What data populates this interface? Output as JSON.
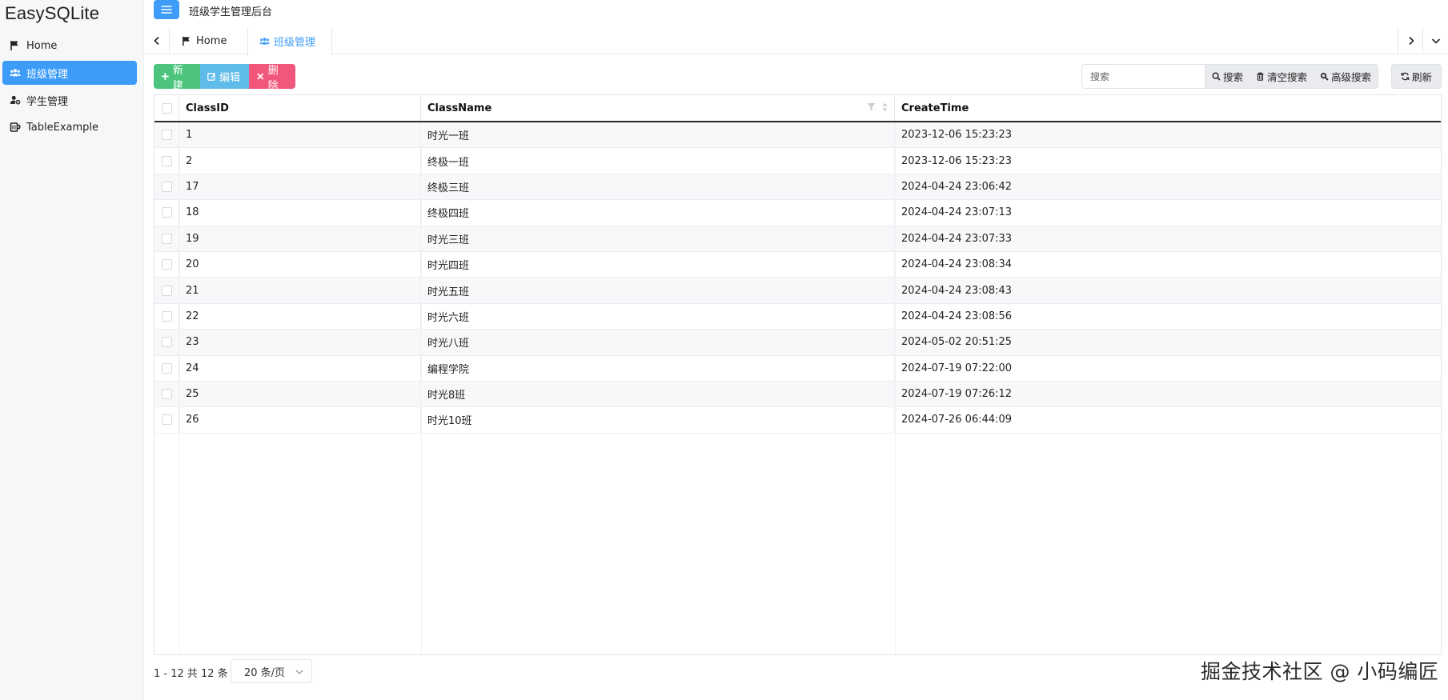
{
  "brand": "EasySQLite",
  "header": {
    "title": "班级学生管理后台"
  },
  "sidebar": {
    "items": [
      {
        "label": "Home",
        "icon": "flag-icon",
        "active": false
      },
      {
        "label": "班级管理",
        "icon": "users-icon",
        "active": true
      },
      {
        "label": "学生管理",
        "icon": "user-cog-icon",
        "active": false
      },
      {
        "label": "TableExample",
        "icon": "mug-icon",
        "active": false
      }
    ]
  },
  "tabs": [
    {
      "label": "Home",
      "icon": "flag-icon",
      "active": false
    },
    {
      "label": "班级管理",
      "icon": "users-icon",
      "active": true
    }
  ],
  "toolbar": {
    "add_label": "新建",
    "edit_label": "编辑",
    "delete_label": "删除",
    "search_placeholder": "搜索",
    "search_label": "搜索",
    "clear_label": "清空搜索",
    "advanced_label": "高级搜索",
    "refresh_label": "刷新"
  },
  "table": {
    "columns": [
      "ClassID",
      "ClassName",
      "CreateTime"
    ],
    "rows": [
      [
        "1",
        "时光一班",
        "2023-12-06 15:23:23"
      ],
      [
        "2",
        "终极一班",
        "2023-12-06 15:23:23"
      ],
      [
        "17",
        "终极三班",
        "2024-04-24 23:06:42"
      ],
      [
        "18",
        "终极四班",
        "2024-04-24 23:07:13"
      ],
      [
        "19",
        "时光三班",
        "2024-04-24 23:07:33"
      ],
      [
        "20",
        "时光四班",
        "2024-04-24 23:08:34"
      ],
      [
        "21",
        "时光五班",
        "2024-04-24 23:08:43"
      ],
      [
        "22",
        "时光六班",
        "2024-04-24 23:08:56"
      ],
      [
        "23",
        "时光八班",
        "2024-05-02 20:51:25"
      ],
      [
        "24",
        "编程学院",
        "2024-07-19 07:22:00"
      ],
      [
        "25",
        "时光8班",
        "2024-07-19 07:26:12"
      ],
      [
        "26",
        "时光10班",
        "2024-07-26 06:44:09"
      ]
    ]
  },
  "pager": {
    "info": "1 - 12 共 12 条",
    "page_size": "20 条/页"
  },
  "watermark": "掘金技术社区 @ 小码编匠",
  "colors": {
    "primary": "#3c9cf8",
    "add": "#4cc47d",
    "edit": "#5fbbe9",
    "delete": "#f1567b"
  }
}
